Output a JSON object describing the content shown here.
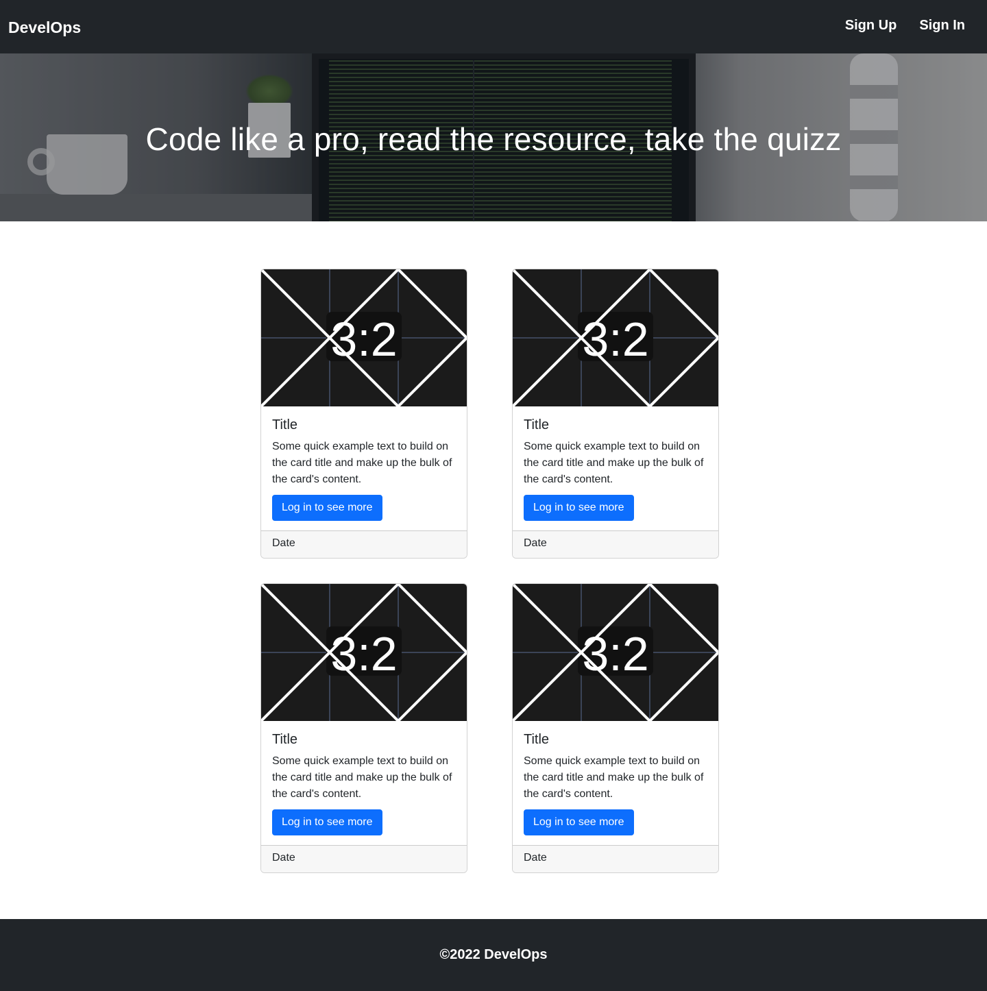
{
  "navbar": {
    "brand": "DevelOps",
    "links": [
      "Sign Up",
      "Sign In"
    ]
  },
  "hero": {
    "headline": "Code like a pro, read the resource, take the quizz"
  },
  "cards": [
    {
      "image_label": "3:2",
      "title": "Title",
      "text": "Some quick example text to build on the card title and make up the bulk of the card's content.",
      "button_label": "Log in to see more",
      "footer": "Date"
    },
    {
      "image_label": "3:2",
      "title": "Title",
      "text": "Some quick example text to build on the card title and make up the bulk of the card's content.",
      "button_label": "Log in to see more",
      "footer": "Date"
    },
    {
      "image_label": "3:2",
      "title": "Title",
      "text": "Some quick example text to build on the card title and make up the bulk of the card's content.",
      "button_label": "Log in to see more",
      "footer": "Date"
    },
    {
      "image_label": "3:2",
      "title": "Title",
      "text": "Some quick example text to build on the card title and make up the bulk of the card's content.",
      "button_label": "Log in to see more",
      "footer": "Date"
    }
  ],
  "footer": {
    "text": "©2022 DevelOps"
  },
  "colors": {
    "navbar_bg": "#212529",
    "primary_button": "#0d6efd",
    "card_footer_bg": "#f7f7f7"
  }
}
